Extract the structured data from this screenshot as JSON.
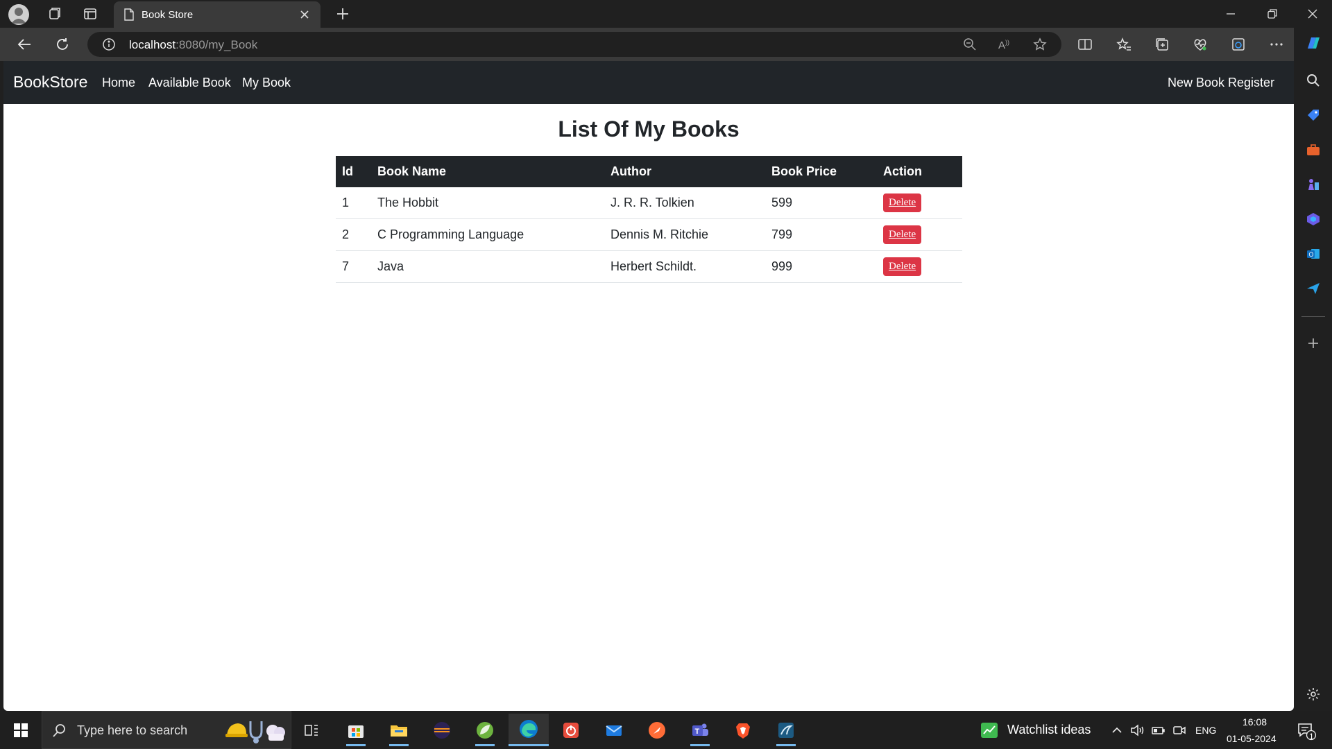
{
  "browser": {
    "tab_title": "Book Store",
    "url_host": "localhost",
    "url_rest": ":8080/my_Book"
  },
  "navbar": {
    "brand": "BookStore",
    "links": [
      "Home",
      "Available Book",
      "My Book"
    ],
    "right_link": "New Book Register"
  },
  "page": {
    "title": "List Of My Books"
  },
  "table": {
    "headers": [
      "Id",
      "Book Name",
      "Author",
      "Book Price",
      "Action"
    ],
    "rows": [
      {
        "id": "1",
        "name": "The Hobbit",
        "author": "J. R. R. Tolkien",
        "price": "599",
        "action": "Delete"
      },
      {
        "id": "2",
        "name": "C Programming Language",
        "author": "Dennis M. Ritchie",
        "price": "799",
        "action": "Delete"
      },
      {
        "id": "7",
        "name": "Java",
        "author": "Herbert Schildt.",
        "price": "999",
        "action": "Delete"
      }
    ]
  },
  "taskbar": {
    "search_placeholder": "Type here to search",
    "widget": "Watchlist ideas",
    "language": "ENG",
    "time": "16:08",
    "date": "01-05-2024",
    "notification_count": "1"
  },
  "colors": {
    "navbar_bg": "#212529",
    "delete_btn": "#dc3545",
    "browser_chrome": "#202020"
  }
}
